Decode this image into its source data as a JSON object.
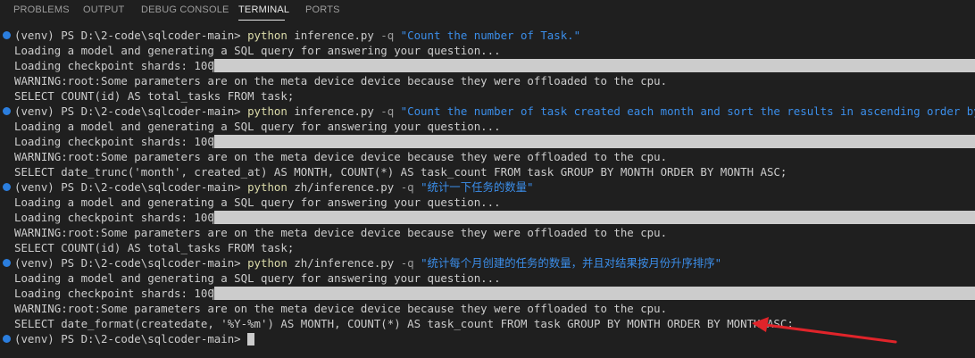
{
  "tabs": [
    {
      "label": "PROBLEMS",
      "active": false
    },
    {
      "label": "OUTPUT",
      "active": false
    },
    {
      "label": "DEBUG CONSOLE",
      "active": false
    },
    {
      "label": "TERMINAL",
      "active": true
    },
    {
      "label": "PORTS",
      "active": false
    }
  ],
  "terminal": {
    "prompt": "(venv) PS D:\\2-code\\sqlcoder-main> ",
    "commands": [
      {
        "program": "python",
        "script": " inference.py ",
        "flag": "-q",
        "query": " \"Count the number of Task.\"",
        "loading": "Loading a model and generating a SQL query for answering your question...",
        "shards": "Loading checkpoint shards: 100%",
        "warning": "WARNING:root:Some parameters are on the meta device device because they were offloaded to the cpu.",
        "sql": "SELECT COUNT(id) AS total_tasks FROM task;"
      },
      {
        "program": "python",
        "script": " inference.py ",
        "flag": "-q",
        "query": " \"Count the number of task created each month and sort the results in ascending order by month.\"",
        "loading": "Loading a model and generating a SQL query for answering your question...",
        "shards": "Loading checkpoint shards: 100%",
        "warning": "WARNING:root:Some parameters are on the meta device device because they were offloaded to the cpu.",
        "sql": "SELECT date_trunc('month', created_at) AS MONTH, COUNT(*) AS task_count FROM task GROUP BY MONTH ORDER BY MONTH ASC;"
      },
      {
        "program": "python",
        "script": " zh/inference.py ",
        "flag": "-q",
        "query": " \"统计一下任务的数量\"",
        "loading": "Loading a model and generating a SQL query for answering your question...",
        "shards": "Loading checkpoint shards: 100%",
        "warning": "WARNING:root:Some parameters are on the meta device device because they were offloaded to the cpu.",
        "sql": "SELECT COUNT(id) AS total_tasks FROM task;"
      },
      {
        "program": "python",
        "script": " zh/inference.py ",
        "flag": "-q",
        "query": " \"统计每个月创建的任务的数量，并且对结果按月份升序排序\"",
        "loading": "Loading a model and generating a SQL query for answering your question...",
        "shards": "Loading checkpoint shards: 100%",
        "warning": "WARNING:root:Some parameters are on the meta device device because they were offloaded to the cpu.",
        "sql": "SELECT date_format(createdate, '%Y-%m') AS MONTH, COUNT(*) AS task_count FROM task GROUP BY MONTH ORDER BY MONTH ASC;"
      }
    ],
    "final_prompt": "(venv) PS D:\\2-code\\sqlcoder-main> "
  },
  "colors": {
    "background": "#1f1f1f",
    "prompt_dot": "#2b7ede",
    "command": "#dcdcaa",
    "string_en": "#ce9178",
    "string_zh": "#3b8eea",
    "annotation_arrow": "#e0242a"
  }
}
